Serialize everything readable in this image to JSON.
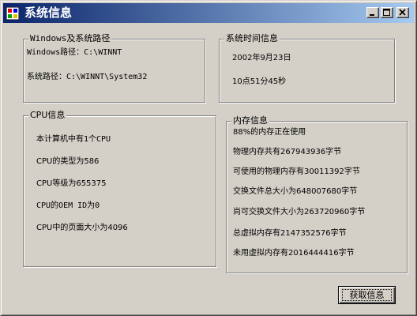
{
  "window": {
    "title": "系统信息",
    "buttons": {
      "minimize": "minimize-icon",
      "maximize": "maximize-icon",
      "close": "close-icon"
    }
  },
  "windows_path": {
    "legend": "Windows及系统路径",
    "lines": [
      "Windows路径：C:\\WINNT",
      "系统路径：C:\\WINNT\\System32"
    ]
  },
  "system_time": {
    "legend": "系统时间信息",
    "date": "2002年9月23日",
    "time": "10点51分45秒"
  },
  "cpu": {
    "legend": "CPU信息",
    "lines": [
      "本计算机中有1个CPU",
      "CPU的类型为586",
      "CPU等级为655375",
      "CPU的OEM ID为0",
      "CPU中的页面大小为4096"
    ]
  },
  "memory": {
    "legend": "内存信息",
    "lines": [
      "88%的内存正在使用",
      "物理内存共有267943936字节",
      "可使用的物理内存有30011392字节",
      "交换文件总大小为648007680字节",
      "尚可交换文件大小为263720960字节",
      "总虚拟内存有2147352576字节",
      "未用虚拟内存有2016444416字节"
    ]
  },
  "actions": {
    "get_info": "获取信息"
  }
}
